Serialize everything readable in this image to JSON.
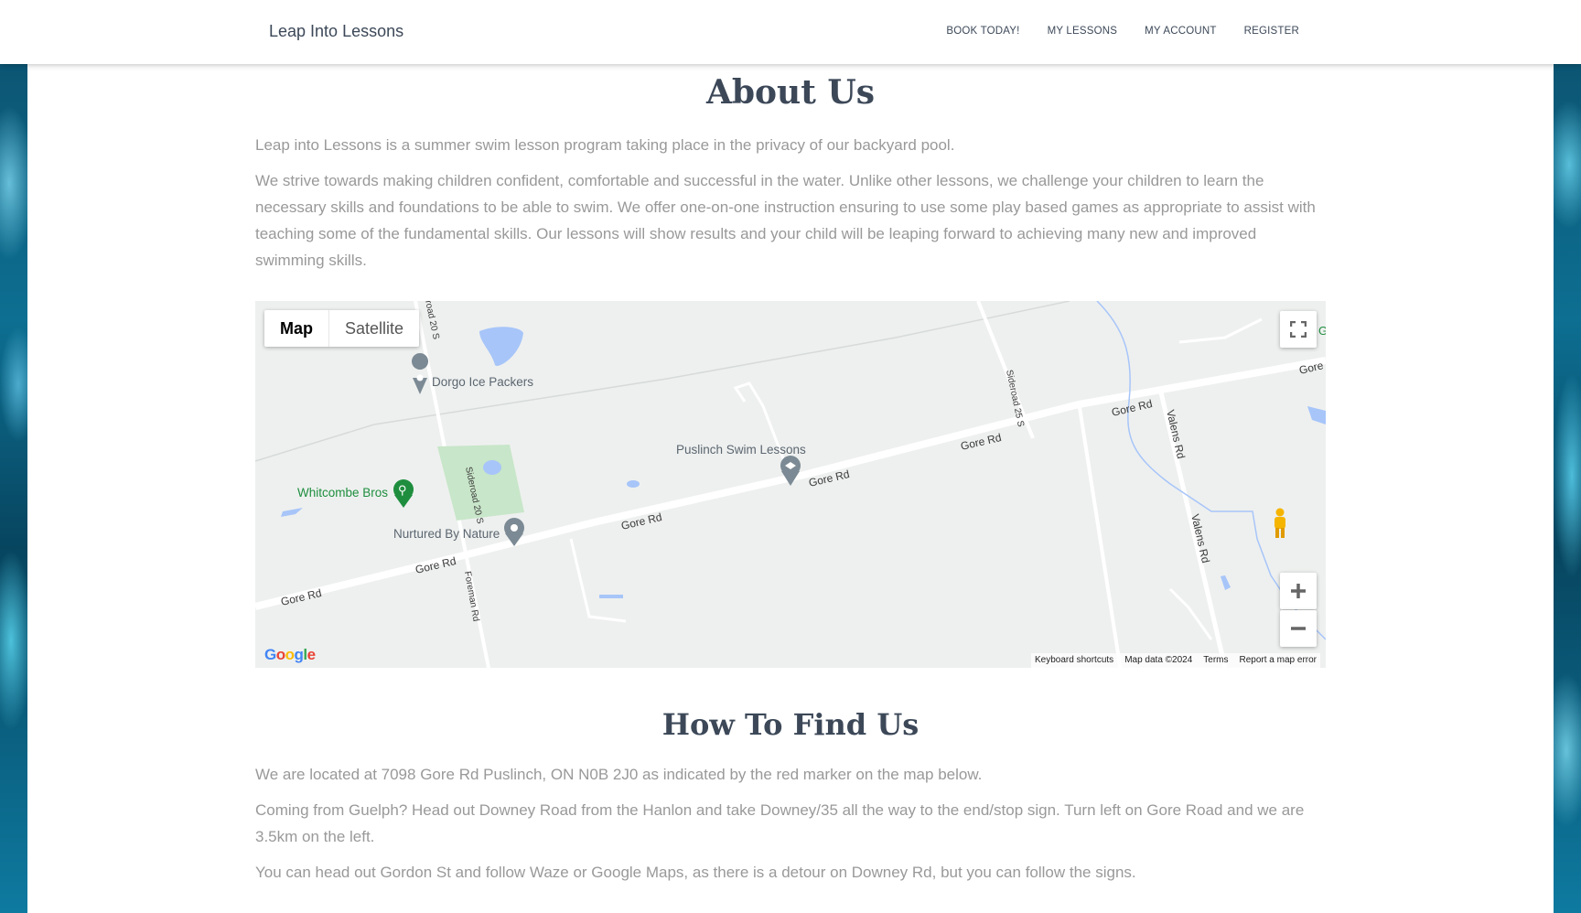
{
  "header": {
    "brand": "Leap Into Lessons",
    "nav": [
      "BOOK TODAY!",
      "MY LESSONS",
      "MY ACCOUNT",
      "REGISTER"
    ]
  },
  "about": {
    "title": "About Us",
    "p1": "Leap into Lessons is a summer swim lesson program taking place in the privacy of our backyard pool.",
    "p2": "We strive towards making children confident, comfortable and successful in the water.  Unlike other lessons, we challenge your children to learn the necessary skills and foundations to be able to swim.  We offer one-on-one instruction ensuring to use some play based games as appropriate to assist with teaching some of the fundamental skills.  Our lessons will show results and your child will be leaping forward to achieving many new and improved swimming skills."
  },
  "map": {
    "type_map": "Map",
    "type_satellite": "Satellite",
    "places": {
      "dorgo": "Dorgo Ice Packers",
      "puslinch": "Puslinch Swim Lessons",
      "whitcombe": "Whitcombe Bros",
      "nurtured": "Nurtured By Nature"
    },
    "roads": {
      "gore": "Gore Rd",
      "gore_short": "Gore",
      "valens": "Valens Rd",
      "sideroad20": "Sideroad 20 S",
      "sideroad20_top": "road 20 S",
      "sideroad25": "Sideroad 25 S",
      "foreman": "Foreman Rd",
      "g_edge": "G"
    },
    "attribution": [
      "Keyboard shortcuts",
      "Map data ©2024",
      "Terms",
      "Report a map error"
    ],
    "logo": "Google",
    "colors": {
      "water": "#a7c5f9",
      "park": "#c8e6c9",
      "road": "#ffffff",
      "poi_green": "#1e8e3e",
      "pin_gray": "#7b8a94"
    }
  },
  "find": {
    "title": "How To Find Us",
    "p1": "We are located at 7098 Gore Rd Puslinch, ON N0B 2J0 as indicated by the red marker on the map below.",
    "p2": "Coming from Guelph? Head out Downey Road from the Hanlon and take Downey/35 all the way to the end/stop sign.  Turn left on Gore Road and we are 3.5km on the left.",
    "p3": "You can head out Gordon St and follow Waze or Google Maps, as there is a detour on Downey Rd, but you can follow the signs."
  }
}
